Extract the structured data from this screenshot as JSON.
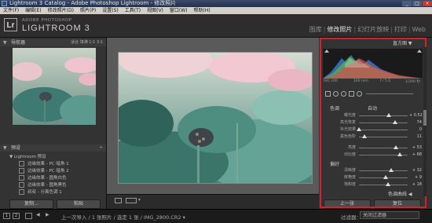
{
  "window": {
    "title": "Lightroom 3 Catalog - Adobe Photoshop Lightroom - 修改照片",
    "buttons": [
      "_",
      "□",
      "×"
    ]
  },
  "menubar": [
    "文件(F)",
    "编辑(E)",
    "修改照片(D)",
    "照片(P)",
    "设置(S)",
    "工具(T)",
    "视图(V)",
    "窗口(W)",
    "帮助(H)"
  ],
  "identity": {
    "logo": "Lr",
    "small": "ADOBE PHOTOSHOP",
    "big": "LIGHTROOM 3"
  },
  "modules": [
    {
      "label": "图库",
      "active": false
    },
    {
      "label": "修改照片",
      "active": true
    },
    {
      "label": "幻灯片放映",
      "active": false
    },
    {
      "label": "打印",
      "active": false
    },
    {
      "label": "Web",
      "active": false
    }
  ],
  "navigator": {
    "title": "导航器",
    "options": "适合  填满  1:1  3:1"
  },
  "presets": {
    "title": "预设",
    "folder": "Lightroom 预设",
    "items": [
      "边缘效果 - PC 暗角 1",
      "边缘效果 - PC 暗角 2",
      "边缘效果 - 圆角白色",
      "边缘效果 - 圆角黑色",
      "叔叔 - 分离色调 1"
    ]
  },
  "left_buttons": {
    "copy": "复制...",
    "paste": "粘贴"
  },
  "histogram": {
    "title": "直方图",
    "info": [
      "ISO 200",
      "160 mm",
      "f / 5.6",
      "1/200 秒"
    ]
  },
  "basic": {
    "section_tone": "色调",
    "auto": "自动",
    "section_presence": "偏好"
  },
  "sliders": [
    {
      "label": "曝光度",
      "value": "+ 0.52",
      "pos": 0.62
    },
    {
      "label": "高光恢复",
      "value": "74",
      "pos": 0.74
    },
    {
      "label": "补光效果",
      "value": "0",
      "pos": 0.0
    },
    {
      "label": "黑色色阶",
      "value": "11",
      "pos": 0.11
    },
    {
      "label": "亮度",
      "value": "+ 53",
      "pos": 0.76
    },
    {
      "label": "对比度",
      "value": "+ 68",
      "pos": 0.84
    },
    {
      "label": "清晰度",
      "value": "+ 32",
      "pos": 0.66
    },
    {
      "label": "鲜艳度",
      "value": "+ 9",
      "pos": 0.55
    },
    {
      "label": "饱和度",
      "value": "+ 18",
      "pos": 0.59
    }
  ],
  "tone_curve": {
    "title": "色调曲线"
  },
  "right_buttons": {
    "previous": "上一张",
    "reset": "复位"
  },
  "filmstrip": {
    "breadcrumb": "上一次导入 / 1 张照片 / 选定 1 张 / IMG_2800.CR2 ▾",
    "filter_label": "过滤器：",
    "filter_value": "关闭过滤器"
  },
  "colors": {
    "highlight_frame": "#d2232a"
  }
}
